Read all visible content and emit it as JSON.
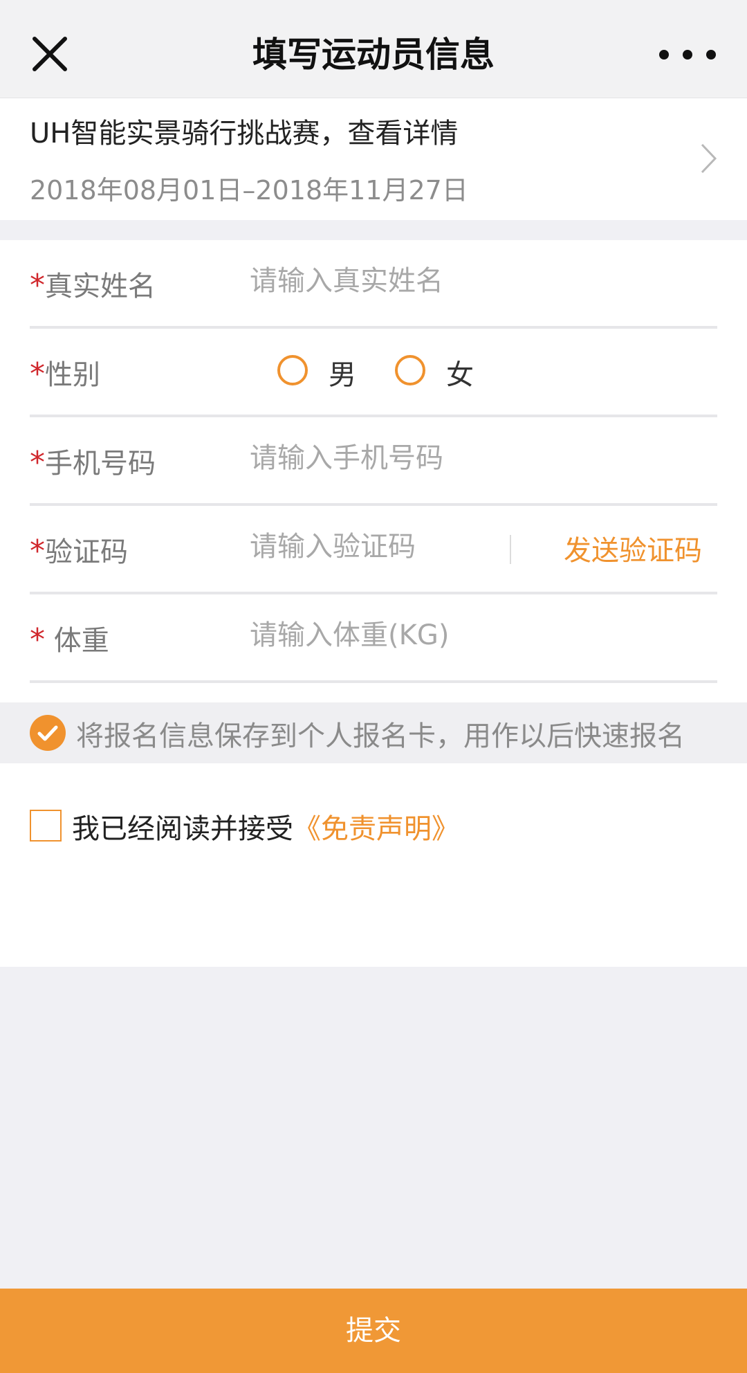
{
  "navbar": {
    "title": "填写运动员信息"
  },
  "event": {
    "title": "UH智能实景骑行挑战赛，查看详情",
    "date_range": "2018年08月01日–2018年11月27日"
  },
  "form": {
    "required_mark": "*",
    "name": {
      "label": "真实姓名",
      "placeholder": "请输入真实姓名"
    },
    "gender": {
      "label": "性别",
      "options": [
        "男",
        "女"
      ]
    },
    "phone": {
      "label": "手机号码",
      "placeholder": "请输入手机号码"
    },
    "code": {
      "label": "验证码",
      "placeholder": "请输入验证码",
      "send_label": "发送验证码"
    },
    "weight": {
      "label": " 体重",
      "placeholder": "请输入体重(KG)"
    }
  },
  "save": {
    "text": "将报名信息保存到个人报名卡，用作以后快速报名",
    "checked": true
  },
  "agreement": {
    "text": "我已经阅读并接受",
    "link": "《免责声明》",
    "checked": false
  },
  "submit": {
    "label": "提交"
  },
  "colors": {
    "accent": "#f0922e",
    "required": "#d0272c",
    "submit_bg": "#f09836"
  }
}
